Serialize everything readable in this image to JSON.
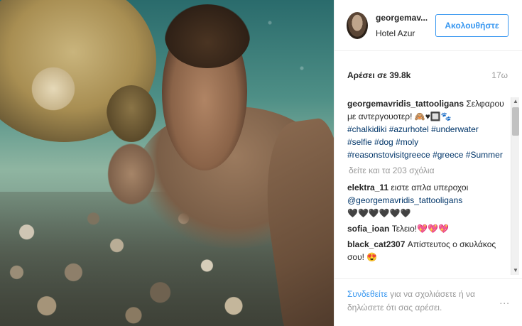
{
  "post": {
    "username": "georgemav...",
    "location": "Hotel Azur",
    "follow_label": "Ακολουθήστε",
    "likes": "Αρέσει σε 39.8k",
    "time": "17ω",
    "caption": {
      "user": "georgemavridis_tattooligans",
      "text": " Σελφαρου με αντεργουοτερ! 🙈♥🔲🐾",
      "tags": [
        "#chalkidiki",
        "#azurhotel",
        "#underwater",
        "#selfie",
        "#dog",
        "#moly",
        "#reasonstovisitgreece",
        "#greece",
        "#Summer"
      ]
    },
    "view_more": "δείτε και τα 203 σχόλια",
    "comments": [
      {
        "user": "elektra_11",
        "text": " ειστε απλα υπεροχοι ",
        "mention": "@georgemavridis_tattooligans",
        "tail": " 🖤🖤🖤🖤🖤🖤"
      },
      {
        "user": "sofia_ioan",
        "text": " Τελειο!💖💖💖"
      },
      {
        "user": "black_cat2307",
        "text": " Απίστευτος ο σκυλάκος σου! 😍"
      }
    ],
    "footer": {
      "login_link": "Συνδεθείτε",
      "login_text": " για να σχολιάσετε ή να δηλώσετε ότι σας αρέσει.",
      "more_icon": "..."
    }
  },
  "colors": {
    "accent": "#3897f0",
    "link": "#003569",
    "muted": "#999999"
  }
}
